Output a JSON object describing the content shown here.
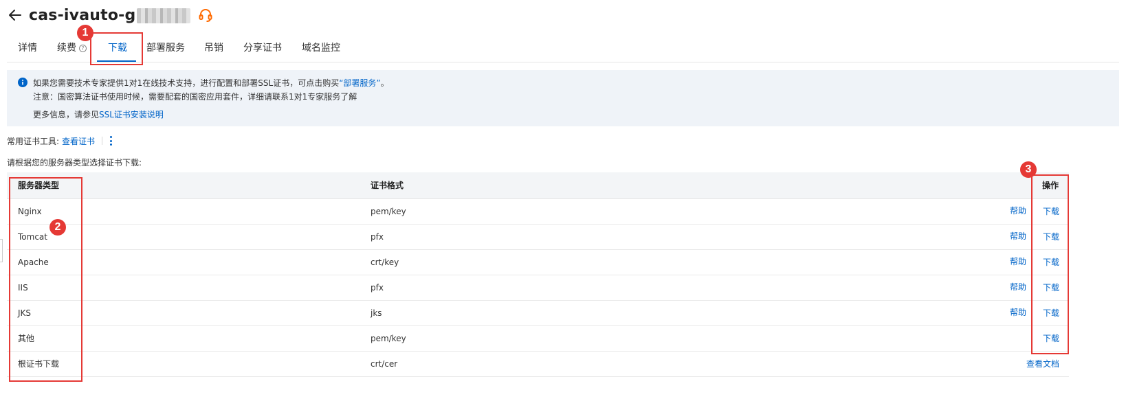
{
  "header": {
    "title": "cas-ivauto-g",
    "back_icon": "arrow-left-icon",
    "support_icon": "headset-icon"
  },
  "tabs": [
    {
      "label": "详情"
    },
    {
      "label": "续费"
    },
    {
      "label": "下载"
    },
    {
      "label": "部署服务"
    },
    {
      "label": "吊销"
    },
    {
      "label": "分享证书"
    },
    {
      "label": "域名监控"
    }
  ],
  "active_tab": "下载",
  "notice": {
    "line1_prefix": "如果您需要技术专家提供1对1在线技术支持，进行配置和部署SSL证书，可点击购买",
    "line1_link": "“部署服务”",
    "line1_suffix": "。",
    "line2": "注意：国密算法证书使用时候，需要配套的国密应用套件，详细请联系1对1专家服务了解",
    "line3_prefix": "更多信息，请参见",
    "line3_link": "SSL证书安装说明"
  },
  "tools": {
    "label": "常用证书工具:",
    "link": "查看证书"
  },
  "instruction": "请根据您的服务器类型选择证书下载:",
  "table": {
    "headers": {
      "type": "服务器类型",
      "format": "证书格式",
      "action": "操作"
    },
    "rows": [
      {
        "type": "Nginx",
        "format": "pem/key",
        "help": "帮助",
        "action": "下载"
      },
      {
        "type": "Tomcat",
        "format": "pfx",
        "help": "帮助",
        "action": "下载"
      },
      {
        "type": "Apache",
        "format": "crt/key",
        "help": "帮助",
        "action": "下载"
      },
      {
        "type": "IIS",
        "format": "pfx",
        "help": "帮助",
        "action": "下载"
      },
      {
        "type": "JKS",
        "format": "jks",
        "help": "帮助",
        "action": "下载"
      },
      {
        "type": "其他",
        "format": "pem/key",
        "help": "",
        "action": "下载"
      },
      {
        "type": "根证书下载",
        "format": "crt/cer",
        "help": "",
        "action": "查看文档"
      }
    ]
  },
  "annotations": [
    "1",
    "2",
    "3"
  ],
  "colors": {
    "accent": "#0064c8",
    "annotation": "#e53935",
    "support_icon": "#ff6a00"
  }
}
